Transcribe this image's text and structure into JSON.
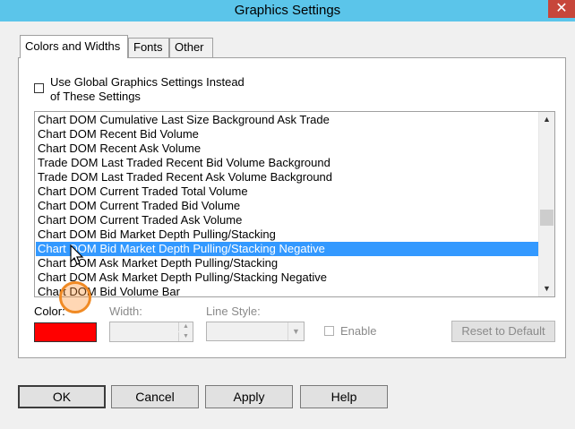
{
  "window": {
    "title": "Graphics Settings",
    "close_glyph": "✕"
  },
  "tabs": [
    {
      "label": "Colors and Widths",
      "active": true
    },
    {
      "label": "Fonts",
      "active": false
    },
    {
      "label": "Other",
      "active": false
    }
  ],
  "global_checkbox": {
    "label_line1": "Use Global Graphics Settings Instead",
    "label_line2": "of These Settings",
    "checked": false
  },
  "list": {
    "items": [
      "Chart DOM Cumulative Last Size Background Ask Trade",
      "Chart DOM Recent Bid Volume",
      "Chart DOM Recent Ask Volume",
      "Trade DOM Last Traded Recent Bid Volume Background",
      "Trade DOM Last Traded Recent Ask Volume Background",
      "Chart DOM Current Traded Total Volume",
      "Chart DOM Current Traded Bid Volume",
      "Chart DOM Current Traded Ask Volume",
      "Chart DOM Bid Market Depth Pulling/Stacking",
      "Chart DOM Bid Market Depth Pulling/Stacking Negative",
      "Chart DOM Ask Market Depth Pulling/Stacking",
      "Chart DOM Ask Market Depth Pulling/Stacking Negative",
      "Chart DOM Bid Volume Bar"
    ],
    "selected_index": 9,
    "scroll_up_glyph": "▲",
    "scroll_down_glyph": "▼"
  },
  "fields": {
    "color_label": "Color:",
    "color_value": "#ff0000",
    "width_label": "Width:",
    "width_value": "",
    "line_style_label": "Line Style:",
    "line_style_value": "",
    "enable_label": "Enable",
    "enable_checked": false,
    "reset_label": "Reset to Default"
  },
  "buttons": {
    "ok": "OK",
    "cancel": "Cancel",
    "apply": "Apply",
    "help": "Help"
  },
  "colors": {
    "titlebar": "#5bc5ea",
    "selection": "#3399ff",
    "close": "#c7463a",
    "highlight_ring": "#f08a24"
  }
}
